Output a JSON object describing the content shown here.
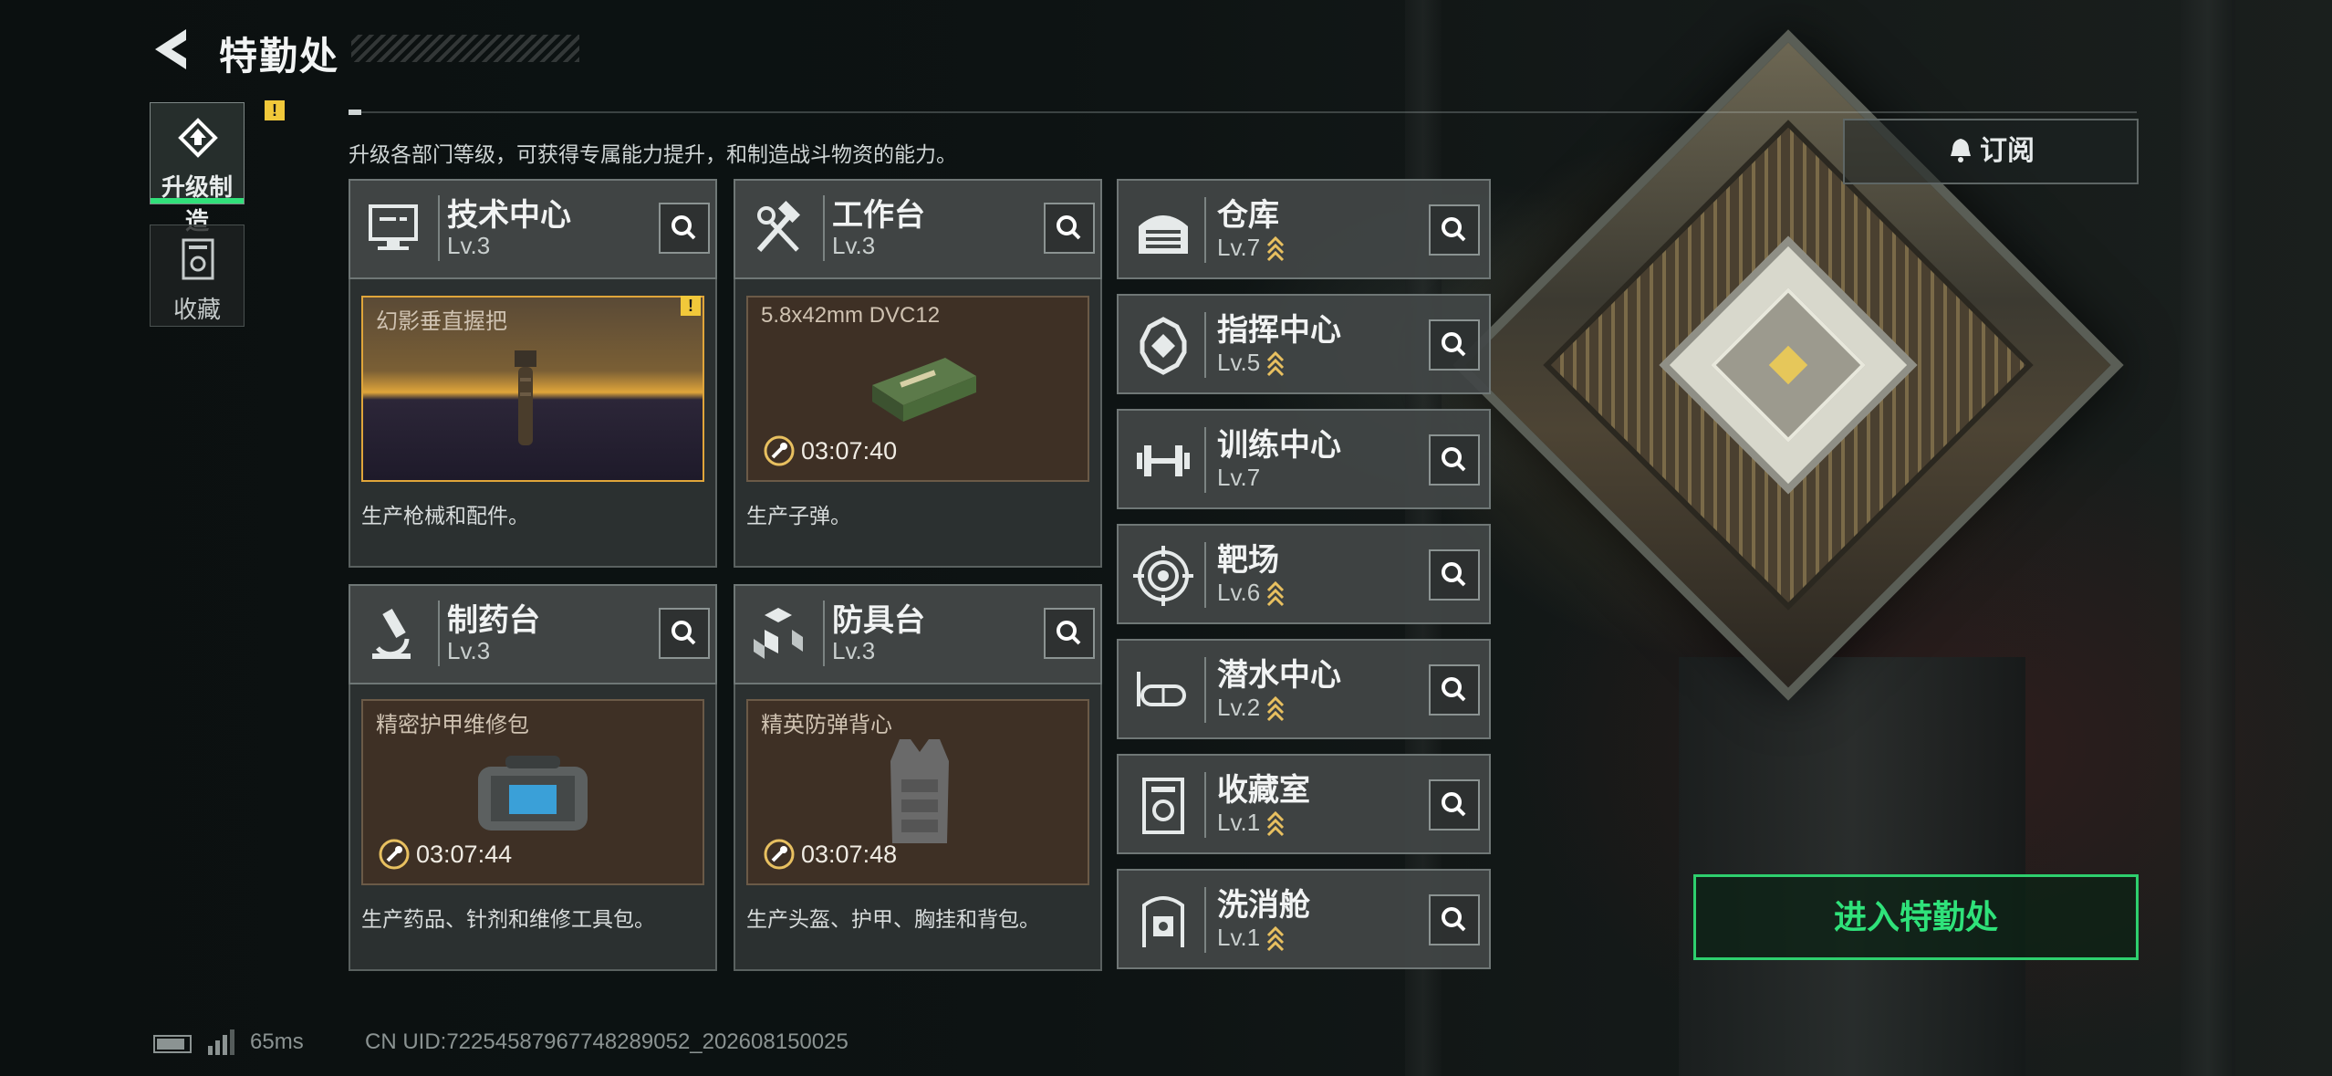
{
  "header": {
    "title": "特勤处"
  },
  "sidebar": {
    "tabs": [
      {
        "label": "升级制造",
        "icon": "upgrade-icon",
        "active": true,
        "alert": "!"
      },
      {
        "label": "收藏",
        "icon": "collection-icon",
        "active": false
      }
    ]
  },
  "description": "升级各部门等级，可获得专属能力提升，和制造战斗物资的能力。",
  "departments": [
    {
      "name": "技术中心",
      "level": "Lv.3",
      "icon": "computer-icon",
      "product": {
        "name": "幻影垂直握把",
        "timer": "",
        "alert": "!"
      },
      "desc": "生产枪械和配件。"
    },
    {
      "name": "工作台",
      "level": "Lv.3",
      "icon": "tools-icon",
      "product": {
        "name": "5.8x42mm DVC12",
        "timer": "03:07:40"
      },
      "desc": "生产子弹。"
    },
    {
      "name": "制药台",
      "level": "Lv.3",
      "icon": "microscope-icon",
      "product": {
        "name": "精密护甲维修包",
        "timer": "03:07:44"
      },
      "desc": "生产药品、针剂和维修工具包。"
    },
    {
      "name": "防具台",
      "level": "Lv.3",
      "icon": "cubes-icon",
      "product": {
        "name": "精英防弹背心",
        "timer": "03:07:48"
      },
      "desc": "生产头盔、护甲、胸挂和背包。"
    }
  ],
  "facilities": [
    {
      "name": "仓库",
      "level": "Lv.7",
      "upgradable": true,
      "icon": "warehouse-icon"
    },
    {
      "name": "指挥中心",
      "level": "Lv.5",
      "upgradable": true,
      "icon": "command-icon"
    },
    {
      "name": "训练中心",
      "level": "Lv.7",
      "upgradable": false,
      "icon": "dumbbell-icon"
    },
    {
      "name": "靶场",
      "level": "Lv.6",
      "upgradable": true,
      "icon": "target-icon"
    },
    {
      "name": "潜水中心",
      "level": "Lv.2",
      "upgradable": true,
      "icon": "diving-mask-icon"
    },
    {
      "name": "收藏室",
      "level": "Lv.1",
      "upgradable": true,
      "icon": "vault-icon"
    },
    {
      "name": "洗消舱",
      "level": "Lv.1",
      "upgradable": true,
      "icon": "decon-icon"
    }
  ],
  "subscribe_label": "订阅",
  "enter_label": "进入特勤处",
  "status": {
    "ping": "65ms",
    "uid": "CN UID:7225458796774828905​2_202608150025"
  },
  "colors": {
    "accent": "#2fe27a",
    "warning": "#f1c83a",
    "upgrade": "#e8c060"
  }
}
